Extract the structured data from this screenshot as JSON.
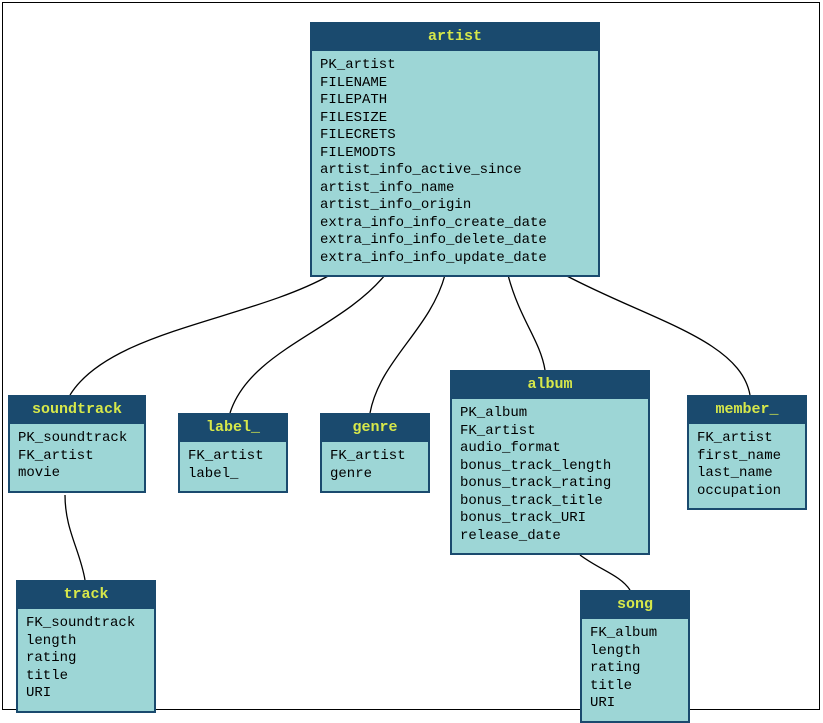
{
  "chart_data": {
    "type": "er-diagram",
    "entities": {
      "artist": {
        "title": "artist",
        "fields": [
          "PK_artist",
          "FILENAME",
          "FILEPATH",
          "FILESIZE",
          "FILECRETS",
          "FILEMODTS",
          "artist_info_active_since",
          "artist_info_name",
          "artist_info_origin",
          "extra_info_info_create_date",
          "extra_info_info_delete_date",
          "extra_info_info_update_date"
        ]
      },
      "soundtrack": {
        "title": "soundtrack",
        "fields": [
          "PK_soundtrack",
          "FK_artist",
          "movie"
        ]
      },
      "label": {
        "title": "label_",
        "fields": [
          "FK_artist",
          "label_"
        ]
      },
      "genre": {
        "title": "genre",
        "fields": [
          "FK_artist",
          "genre"
        ]
      },
      "album": {
        "title": "album",
        "fields": [
          "PK_album",
          "FK_artist",
          "audio_format",
          "bonus_track_length",
          "bonus_track_rating",
          "bonus_track_title",
          "bonus_track_URI",
          "release_date"
        ]
      },
      "member": {
        "title": "member_",
        "fields": [
          "FK_artist",
          "first_name",
          "last_name",
          "occupation"
        ]
      },
      "track": {
        "title": "track",
        "fields": [
          "FK_soundtrack",
          "length",
          "rating",
          "title",
          "URI"
        ]
      },
      "song": {
        "title": "song",
        "fields": [
          "FK_album",
          "length",
          "rating",
          "title",
          "URI"
        ]
      }
    },
    "relationships": [
      {
        "from": "artist",
        "to": "soundtrack"
      },
      {
        "from": "artist",
        "to": "label"
      },
      {
        "from": "artist",
        "to": "genre"
      },
      {
        "from": "artist",
        "to": "album"
      },
      {
        "from": "artist",
        "to": "member"
      },
      {
        "from": "soundtrack",
        "to": "track"
      },
      {
        "from": "album",
        "to": "song"
      }
    ]
  }
}
